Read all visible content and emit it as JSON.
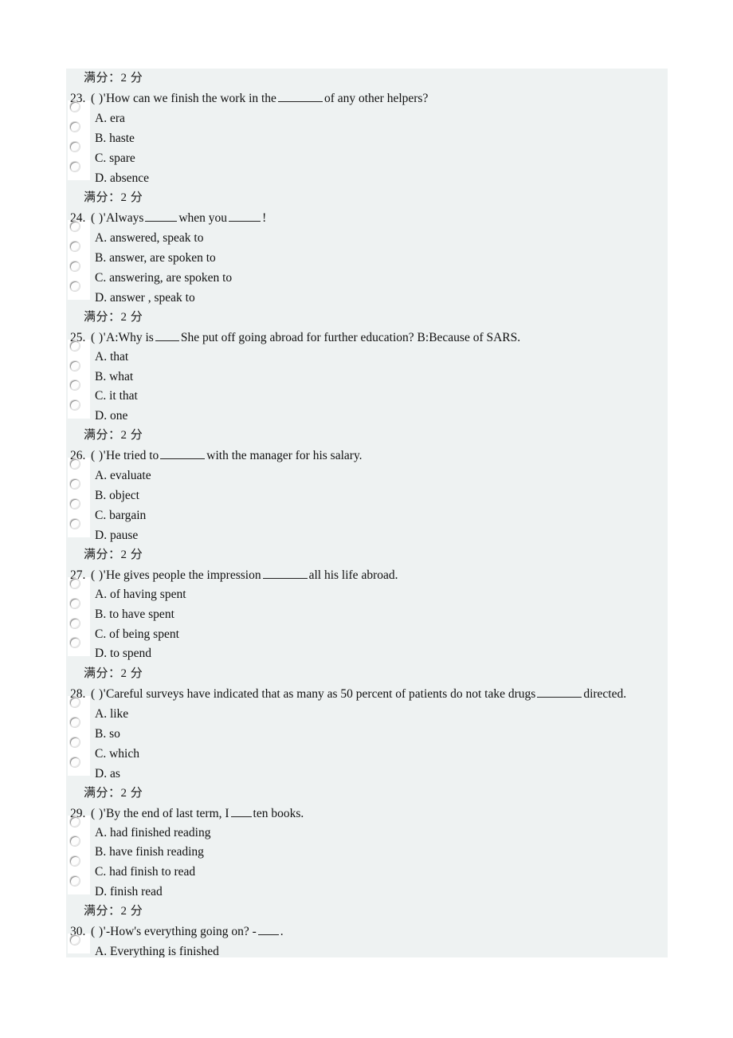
{
  "page": {
    "background_color": "#ffffff",
    "panel_background_color": "#eef2f2",
    "radio_strip_color": "#ffffff",
    "text_color": "#111111"
  },
  "score_label": "满分：2 分",
  "questions": [
    {
      "number": "23.",
      "marker": "( )'",
      "stem_before": "How can we finish the work in the",
      "stem_after": "of any other helpers?",
      "has_blank": true,
      "blank_width": 56,
      "options": [
        "A. era",
        "B. haste",
        "C. spare",
        "D. absence"
      ]
    },
    {
      "number": "24.",
      "marker": "( )'",
      "stem_before": "Always",
      "stem_after": "when you",
      "stem_tail": "!",
      "has_blank": true,
      "blank_width": 40,
      "blank2_width": 40,
      "options": [
        "A. answered, speak to",
        "B. answer, are spoken to",
        "C. answering, are spoken to",
        "D. answer , speak to"
      ]
    },
    {
      "number": "25.",
      "marker": "( )'",
      "stem_before": "A:Why is",
      "stem_after": "She put off going abroad for further education? B:Because of SARS.",
      "has_blank": true,
      "blank_width": 30,
      "options": [
        "A. that",
        "B. what",
        "C. it that",
        "D. one"
      ]
    },
    {
      "number": "26.",
      "marker": "( )'",
      "stem_before": "He tried to",
      "stem_after": "with the manager for his salary.",
      "has_blank": true,
      "blank_width": 56,
      "options": [
        "A. evaluate",
        "B. object",
        "C. bargain",
        "D. pause"
      ]
    },
    {
      "number": "27.",
      "marker": "( )'",
      "stem_before": "He gives people the impression",
      "stem_after": "all his life abroad.",
      "has_blank": true,
      "blank_width": 56,
      "options": [
        "A. of having spent",
        "B. to have spent",
        "C. of being spent",
        "D. to spend"
      ]
    },
    {
      "number": "28.",
      "marker": "( )'",
      "stem_before": "Careful surveys have indicated that as many as 50 percent of patients do not take drugs",
      "stem_after": "directed.",
      "has_blank": true,
      "blank_width": 56,
      "options": [
        "A. like",
        "B. so",
        "C. which",
        "D. as"
      ]
    },
    {
      "number": "29.",
      "marker": "( )'",
      "stem_before": "By the end of last term, I",
      "stem_after": "ten books.",
      "has_blank": true,
      "blank_width": 26,
      "options": [
        "A. had finished reading",
        "B. have finish reading",
        "C. had finish to read",
        "D. finish read"
      ]
    },
    {
      "number": "30.",
      "marker": "( )'",
      "stem_before": "-How's everything going on? -",
      "stem_after": ".",
      "has_blank": true,
      "blank_width": 26,
      "options": [
        "A. Everything is finished"
      ]
    }
  ]
}
